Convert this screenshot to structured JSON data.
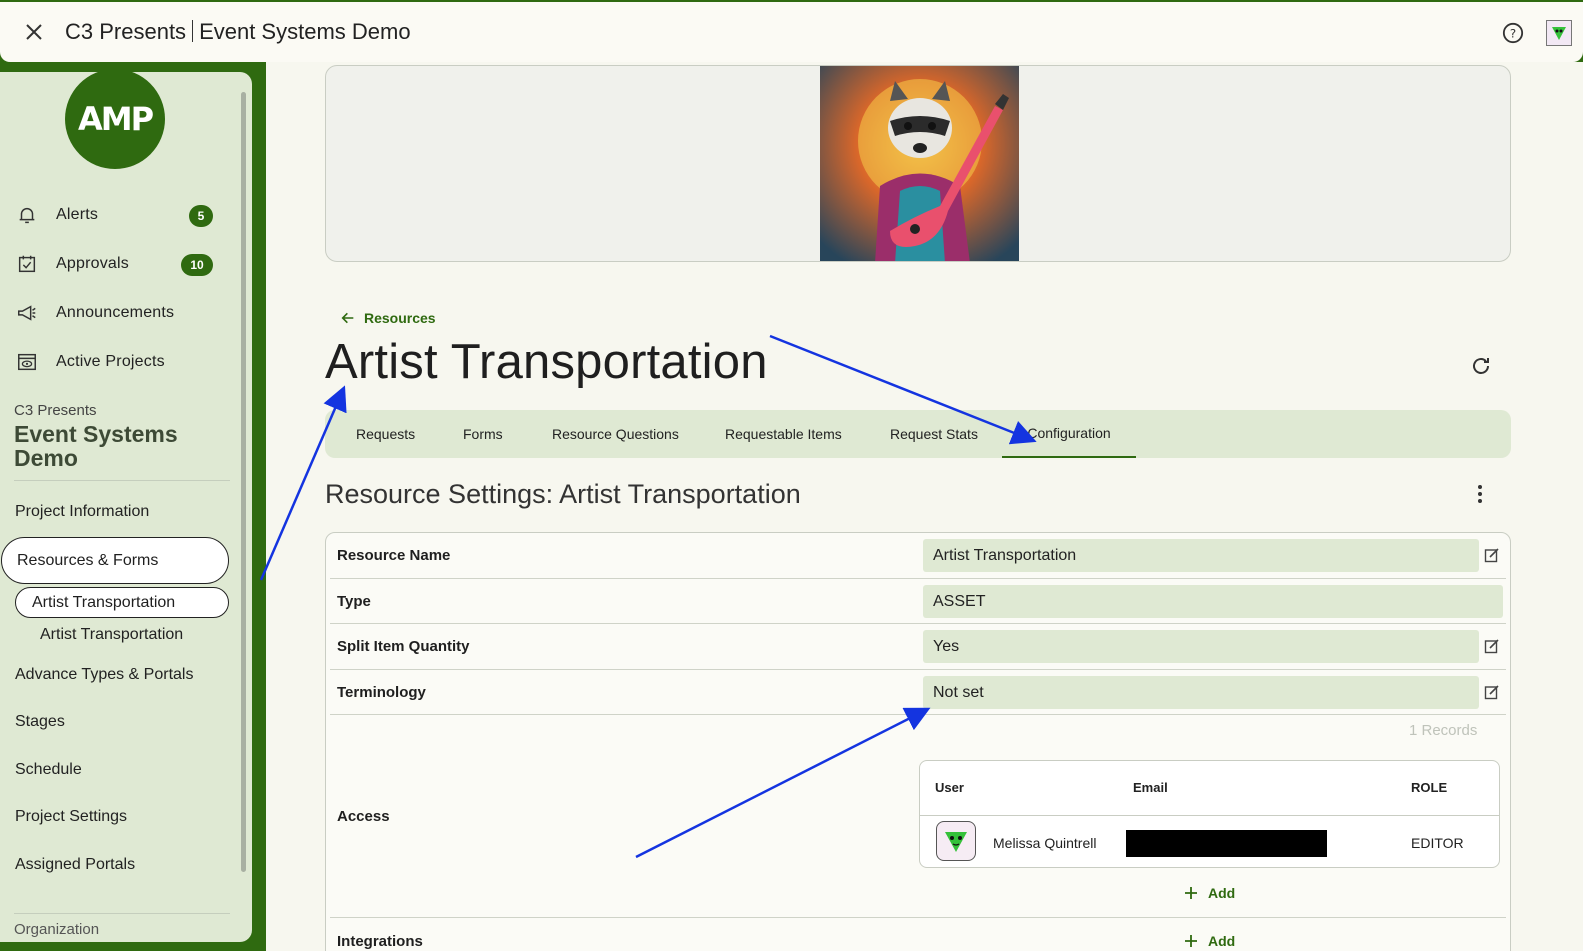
{
  "topbar": {
    "org": "C3 Presents",
    "project": "Event Systems Demo"
  },
  "sidebar": {
    "logo_text": "AMP",
    "nav": [
      {
        "label": "Alerts",
        "badge": "5"
      },
      {
        "label": "Approvals",
        "badge": "10"
      },
      {
        "label": "Announcements"
      },
      {
        "label": "Active Projects"
      }
    ],
    "org_name": "C3 Presents",
    "project_name": "Event Systems Demo",
    "links": {
      "project_information": "Project Information",
      "resources_forms": "Resources & Forms",
      "resource_pill": "Artist Transportation",
      "resource_sub": "Artist Transportation",
      "advance_types": "Advance Types & Portals",
      "stages": "Stages",
      "schedule": "Schedule",
      "project_settings": "Project Settings",
      "assigned_portals": "Assigned Portals",
      "organization": "Organization"
    }
  },
  "main": {
    "back_label": "Resources",
    "title": "Artist Transportation",
    "tabs": [
      "Requests",
      "Forms",
      "Resource Questions",
      "Requestable Items",
      "Request Stats",
      "Configuration"
    ],
    "active_tab": "Configuration",
    "section_title": "Resource Settings: Artist Transportation",
    "settings": [
      {
        "label": "Resource Name",
        "value": "Artist Transportation",
        "editable": true
      },
      {
        "label": "Type",
        "value": "ASSET",
        "editable": false
      },
      {
        "label": "Split Item Quantity",
        "value": "Yes",
        "editable": true
      },
      {
        "label": "Terminology",
        "value": "Not set",
        "editable": true
      }
    ],
    "access": {
      "label": "Access",
      "records": "1 Records",
      "columns": [
        "User",
        "Email",
        "ROLE"
      ],
      "rows": [
        {
          "user": "Melissa Quintrell",
          "email": "",
          "role": "EDITOR"
        }
      ],
      "add_label": "Add"
    },
    "integrations": {
      "label": "Integrations",
      "add_label": "Add"
    }
  },
  "colors": {
    "brand_green": "#2f6a10",
    "light_green": "#dfe9d3",
    "annotation_arrow": "#1434e0"
  }
}
